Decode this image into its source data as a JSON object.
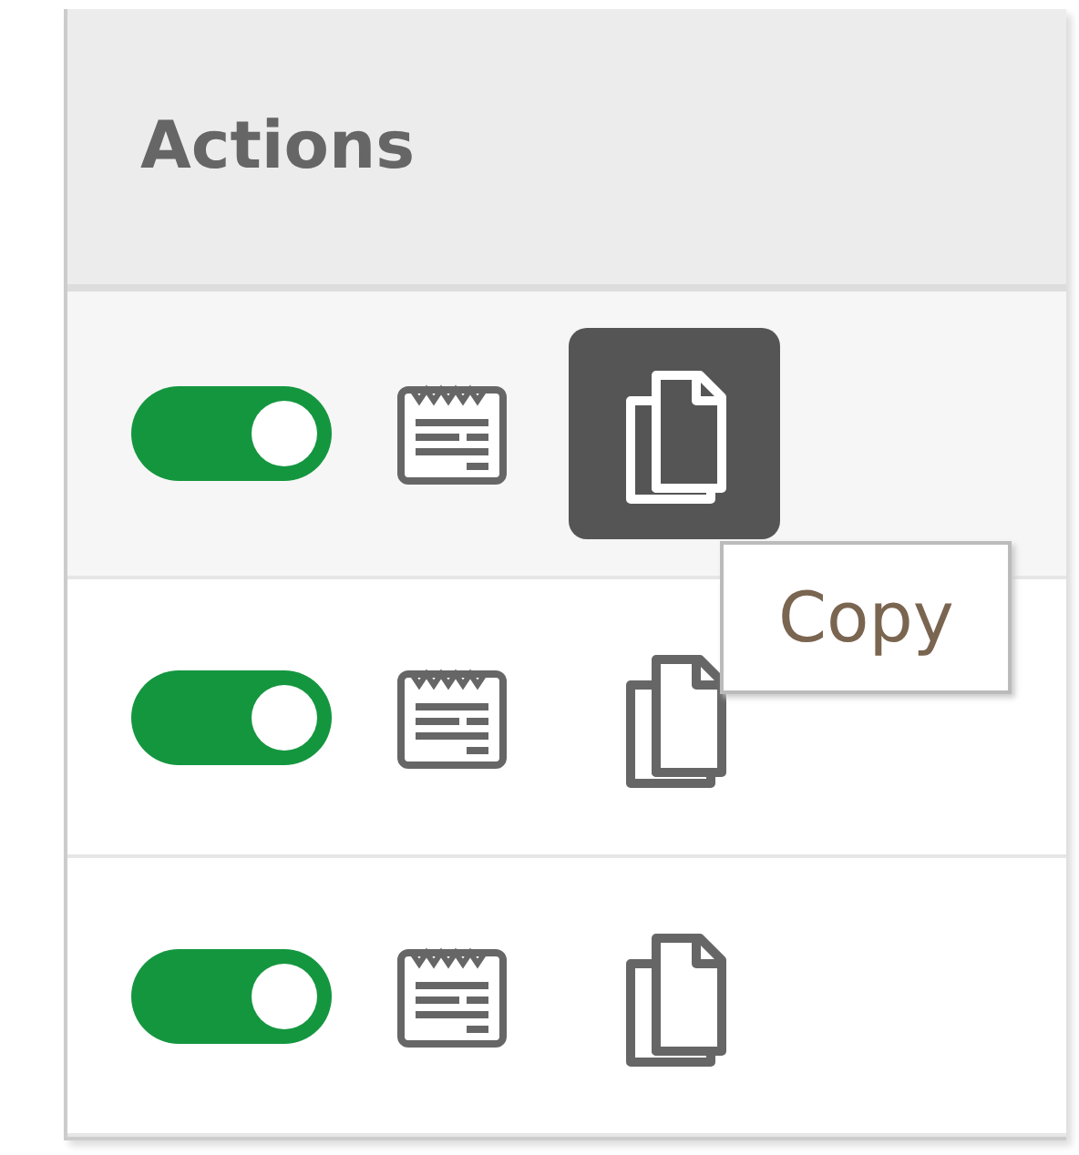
{
  "table": {
    "header": "Actions",
    "rows": [
      {
        "enabled": true,
        "copy_highlighted": true
      },
      {
        "enabled": true,
        "copy_highlighted": false
      },
      {
        "enabled": true,
        "copy_highlighted": false
      }
    ]
  },
  "tooltip": {
    "text": "Copy"
  }
}
